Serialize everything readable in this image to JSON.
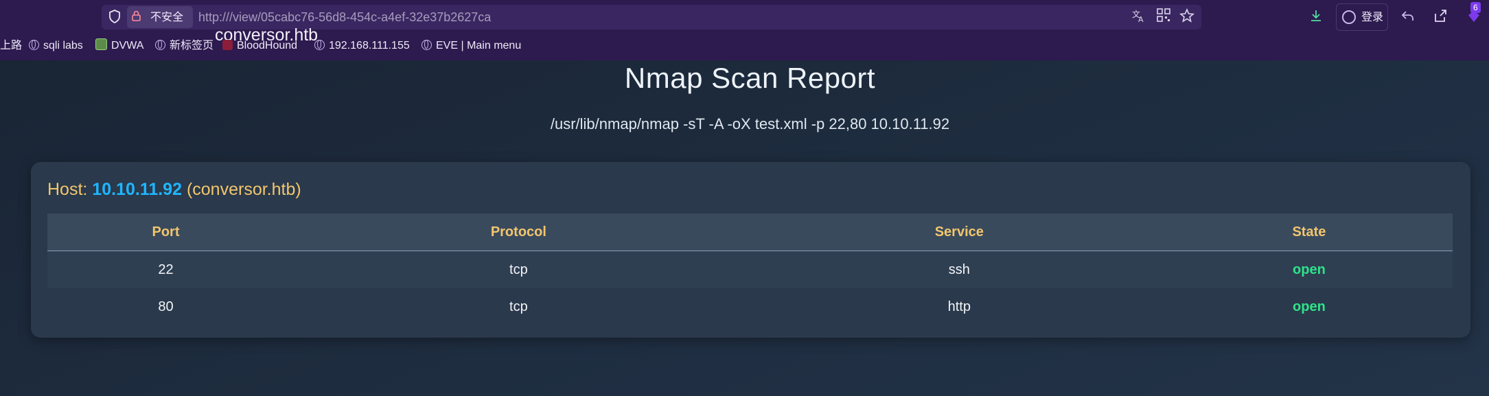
{
  "browser": {
    "security_label": "不安全",
    "url_prefix": "http://",
    "url_host": "conversor.htb",
    "url_path": "/view/05cabc76-56d8-454c-a4ef-32e37b2627ca",
    "login_label": "登录",
    "extension_badge": "6",
    "bookmarks": [
      {
        "label": "上路",
        "icon": "none"
      },
      {
        "label": "sqli labs",
        "icon": "globe-icon"
      },
      {
        "label": "DVWA",
        "icon": "dvwa-favicon"
      },
      {
        "label": "新标签页",
        "icon": "globe-icon"
      },
      {
        "label": "BloodHound",
        "icon": "bloodhound-favicon"
      },
      {
        "label": "192.168.111.155",
        "icon": "globe-icon"
      },
      {
        "label": "EVE | Main menu",
        "icon": "globe-icon"
      }
    ],
    "toolbar_icons": [
      "shield-icon",
      "translate-icon",
      "qr-code-icon",
      "star-icon",
      "download-icon",
      "account-icon",
      "undo-icon",
      "extensions-icon"
    ]
  },
  "report": {
    "title": "Nmap Scan Report",
    "command": "/usr/lib/nmap/nmap -sT -A -oX test.xml -p 22,80 10.10.11.92",
    "host_prefix": "Host: ",
    "host_ip": "10.10.11.92",
    "host_name": "(conversor.htb)",
    "columns": [
      "Port",
      "Protocol",
      "Service",
      "State"
    ],
    "rows": [
      {
        "port": "22",
        "protocol": "tcp",
        "service": "ssh",
        "state": "open"
      },
      {
        "port": "80",
        "protocol": "tcp",
        "service": "http",
        "state": "open"
      }
    ]
  },
  "colors": {
    "browser_chrome": "#2d1a4f",
    "page_background": "#1b2a3a",
    "card_background": "#2a394b",
    "accent_yellow": "#f2c66d",
    "ip_blue": "#1fb6ff",
    "state_open_green": "#2ee38a"
  }
}
